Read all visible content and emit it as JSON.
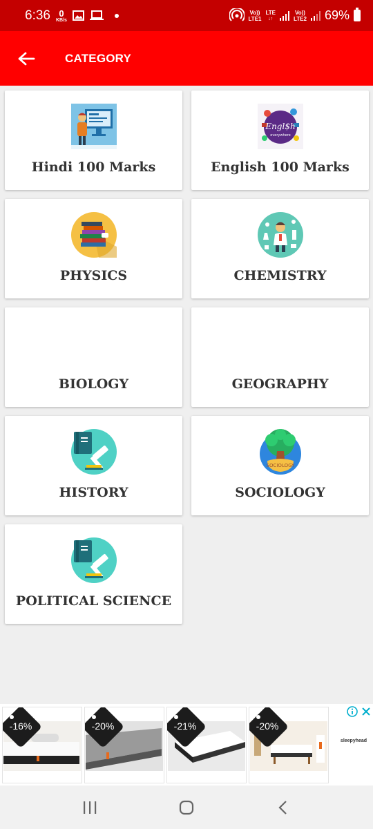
{
  "status_bar": {
    "time": "6:36",
    "net_speed_value": "0",
    "net_speed_unit": "KB/s",
    "sim1_top": "Vo))",
    "sim1_bottom": "LTE1",
    "lte_label": "LTE",
    "sim2_top": "Vo))",
    "sim2_bottom": "LTE2",
    "battery": "69%"
  },
  "app_bar": {
    "title": "CATEGORY",
    "back_icon": "arrow-left-icon"
  },
  "categories": [
    {
      "label": "Hindi 100 Marks",
      "icon": "computer-teacher-icon"
    },
    {
      "label": "English 100 Marks",
      "icon": "english-everywhere-icon"
    },
    {
      "label": "PHYSICS",
      "icon": "books-stack-icon"
    },
    {
      "label": "CHEMISTRY",
      "icon": "chemist-icon"
    },
    {
      "label": "BIOLOGY",
      "icon": ""
    },
    {
      "label": "GEOGRAPHY",
      "icon": ""
    },
    {
      "label": "HISTORY",
      "icon": "law-book-gavel-icon"
    },
    {
      "label": "SOCIOLOGY",
      "icon": "sociology-tree-icon"
    },
    {
      "label": "POLITICAL SCIENCE",
      "icon": "law-book-gavel-icon"
    }
  ],
  "ad": {
    "items": [
      {
        "discount": "-16%"
      },
      {
        "discount": "-20%"
      },
      {
        "discount": "-21%"
      },
      {
        "discount": "-20%"
      }
    ],
    "brand": "sleepyhead"
  },
  "colors": {
    "status_bar": "#c40000",
    "app_bar": "#ff0000",
    "background": "#efefef",
    "card": "#ffffff",
    "label": "#333333"
  }
}
